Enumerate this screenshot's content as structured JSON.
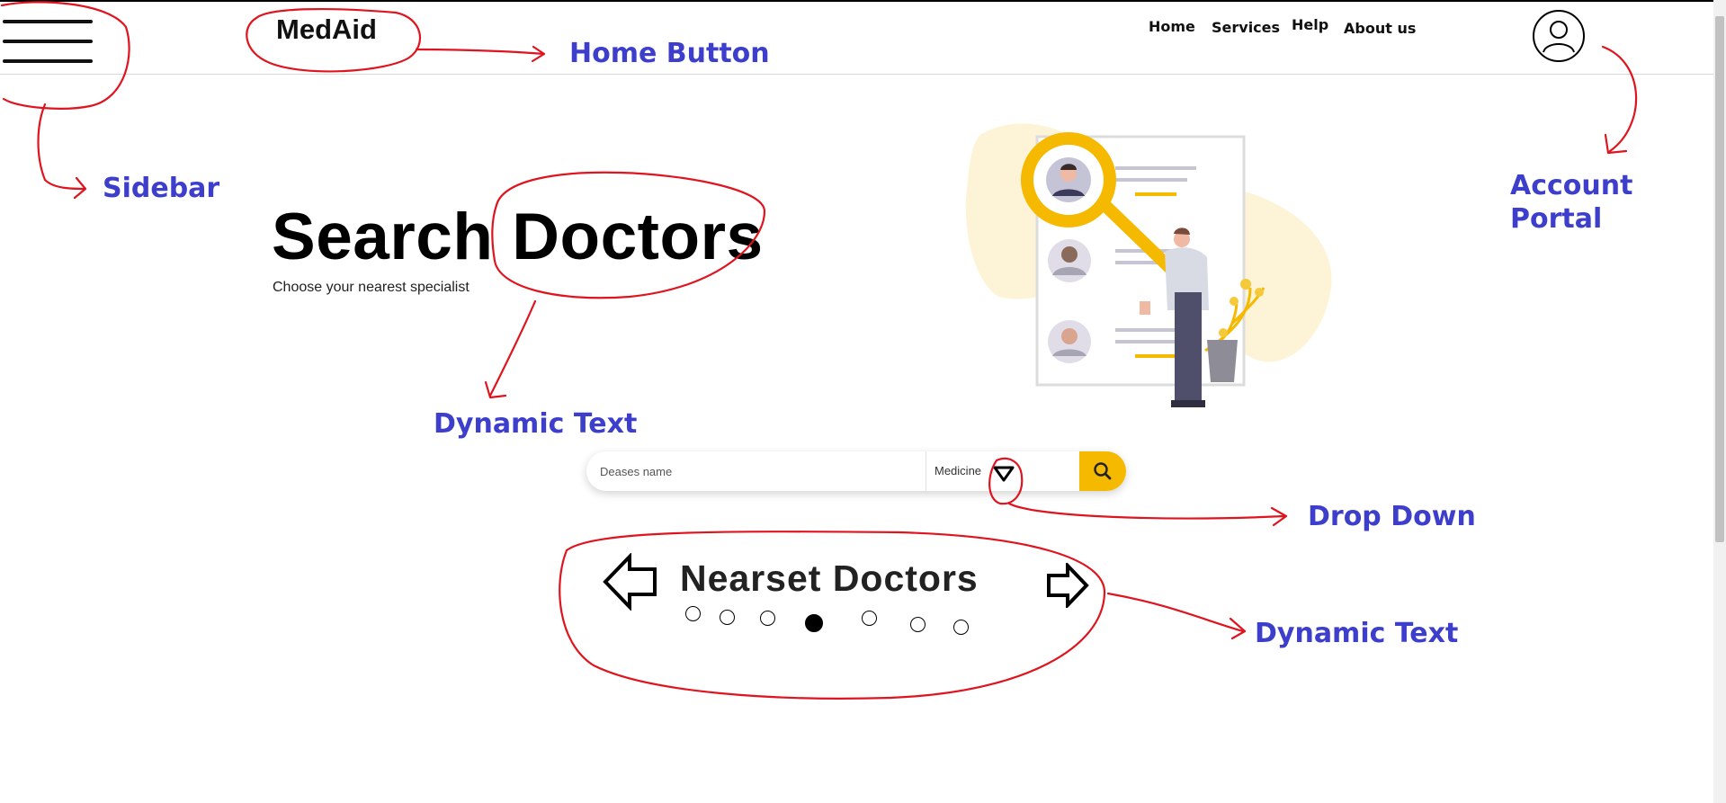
{
  "header": {
    "logo": "MedAid",
    "nav": [
      "Home",
      "Services",
      "Help",
      "About us"
    ]
  },
  "hero": {
    "title": "Search Doctors",
    "subtitle": "Choose your nearest specialist"
  },
  "search": {
    "placeholder": "Deases name",
    "category": "Medicine"
  },
  "carousel": {
    "title": "Nearset Doctors",
    "total_slides": 7,
    "active_index": 3
  },
  "annotations": {
    "home_button": "Home Button",
    "sidebar": "Sidebar",
    "account_line1": "Account",
    "account_line2": "Portal",
    "dynamic_text_1": "Dynamic Text",
    "drop_down": "Drop Down",
    "dynamic_text_2": "Dynamic Text"
  },
  "colors": {
    "accent": "#f5b900",
    "annotation_text": "#3d3fcc",
    "annotation_stroke": "#e0141e"
  }
}
